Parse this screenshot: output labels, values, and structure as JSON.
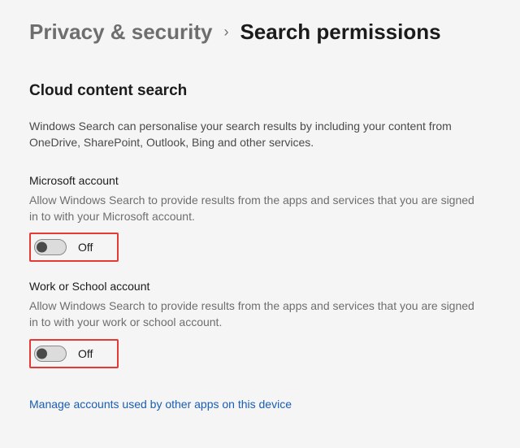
{
  "breadcrumb": {
    "parent": "Privacy & security",
    "separator": "›",
    "current": "Search permissions"
  },
  "section": {
    "title": "Cloud content search",
    "description": "Windows Search can personalise your search results by including your content from OneDrive, SharePoint, Outlook, Bing and other services."
  },
  "settings": [
    {
      "name": "Microsoft account",
      "description": "Allow Windows Search to provide results from the apps and services that you are signed in to with your Microsoft account.",
      "state_label": "Off",
      "state": false
    },
    {
      "name": "Work or School account",
      "description": "Allow Windows Search to provide results from the apps and services that you are signed in to with your work or school account.",
      "state_label": "Off",
      "state": false
    }
  ],
  "link": {
    "label": "Manage accounts used by other apps on this device"
  }
}
